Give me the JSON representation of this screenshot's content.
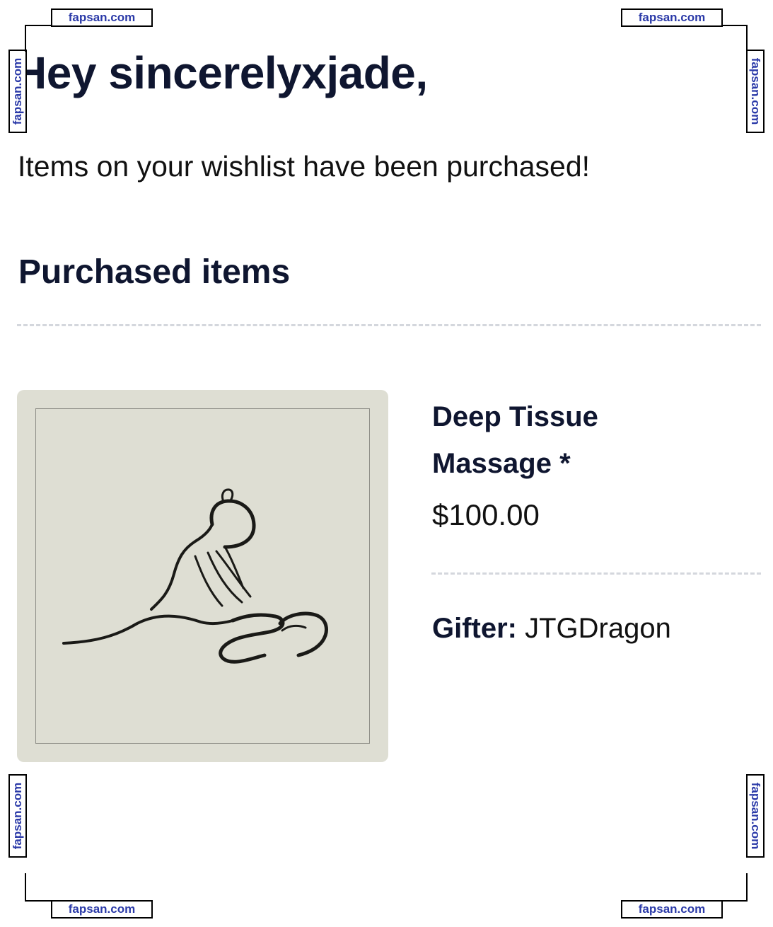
{
  "email": {
    "greeting": "Hey sincerelyxjade,",
    "message": "Items on your wishlist have been purchased!",
    "section_title": "Purchased items"
  },
  "items": [
    {
      "name": "Deep Tissue Massage *",
      "price": "$100.00",
      "gifter_label": "Gifter:",
      "gifter_name": "JTGDragon",
      "image_icon": "massage-illustration"
    }
  ],
  "watermark": {
    "text": "fapsan.com"
  },
  "colors": {
    "heading": "#0f1630",
    "divider": "#d4d7dd",
    "image_background": "#deded3",
    "watermark_text": "#2b3aa8"
  }
}
